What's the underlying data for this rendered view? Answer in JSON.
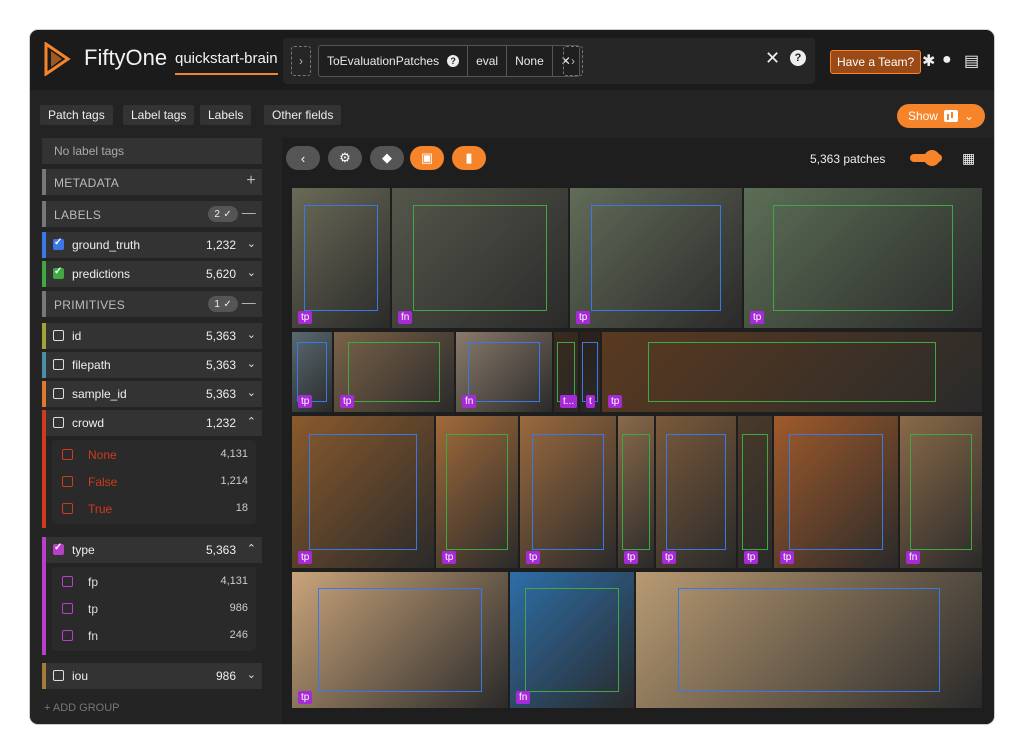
{
  "app": {
    "brand": "FiftyOne",
    "dataset": "quickstart-brain"
  },
  "view_bar": {
    "stage": "ToEvaluationPatches",
    "arg1": "eval",
    "arg2": "None"
  },
  "header": {
    "team_button": "Have a Team?"
  },
  "tabs": [
    "Patch tags",
    "Label tags",
    "Labels",
    "Other fields"
  ],
  "show_button": "Show",
  "sidebar": {
    "label_tags_placeholder": "No label tags",
    "metadata": "METADATA",
    "labels": "LABELS",
    "labels_badge": "2 ✓",
    "ground_truth": {
      "name": "ground_truth",
      "count": "1,232"
    },
    "predictions": {
      "name": "predictions",
      "count": "5,620"
    },
    "primitives": "PRIMITIVES",
    "primitives_badge": "1 ✓",
    "fields": [
      {
        "name": "id",
        "count": "5,363"
      },
      {
        "name": "filepath",
        "count": "5,363"
      },
      {
        "name": "sample_id",
        "count": "5,363"
      },
      {
        "name": "crowd",
        "count": "1,232"
      }
    ],
    "crowd_values": [
      {
        "name": "None",
        "count": "4,131"
      },
      {
        "name": "False",
        "count": "1,214"
      },
      {
        "name": "True",
        "count": "18"
      }
    ],
    "type": {
      "name": "type",
      "count": "5,363"
    },
    "type_values": [
      {
        "name": "fp",
        "count": "4,131"
      },
      {
        "name": "tp",
        "count": "986"
      },
      {
        "name": "fn",
        "count": "246"
      }
    ],
    "iou": {
      "name": "iou",
      "count": "986"
    },
    "add_group": "+ ADD GROUP"
  },
  "grid": {
    "patch_count": "5,363 patches",
    "tags": [
      "tp",
      "fn",
      "tp",
      "tp",
      "tp",
      "tp",
      "fn",
      "t...",
      "t",
      "tp",
      "tp",
      "tp",
      "tp",
      "tp",
      "tp",
      "tp",
      "tp",
      "fn",
      "tp",
      "fn"
    ]
  },
  "colors": {
    "accent": "#f6842a",
    "ground_truth": "#3a78e8",
    "predictions": "#3ea843",
    "crowd": "#d03a1e",
    "type": "#b83fc9",
    "tag": "#a62ad6"
  }
}
